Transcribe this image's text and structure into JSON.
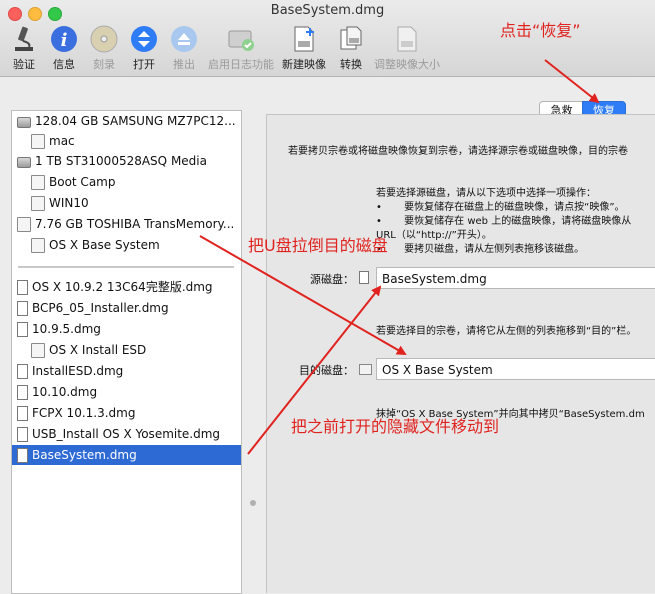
{
  "window": {
    "title": "BaseSystem.dmg"
  },
  "toolbar": {
    "items": [
      {
        "label": "验证",
        "enabled": true
      },
      {
        "label": "信息",
        "enabled": true
      },
      {
        "label": "刻录",
        "enabled": false
      },
      {
        "label": "打开",
        "enabled": true
      },
      {
        "label": "推出",
        "enabled": false
      },
      {
        "label": "启用日志功能",
        "enabled": false
      },
      {
        "label": "新建映像",
        "enabled": true
      },
      {
        "label": "转换",
        "enabled": true
      },
      {
        "label": "调整映像大小",
        "enabled": false
      }
    ]
  },
  "sidebar": {
    "items": [
      {
        "label": "128.04 GB SAMSUNG MZ7PC12...",
        "kind": "drive",
        "selected": false
      },
      {
        "label": "mac",
        "kind": "volume",
        "selected": false
      },
      {
        "label": "1 TB ST31000528ASQ Media",
        "kind": "drive",
        "selected": false
      },
      {
        "label": "Boot Camp",
        "kind": "volume",
        "selected": false
      },
      {
        "label": "WIN10",
        "kind": "volume",
        "selected": false
      },
      {
        "label": "7.76 GB TOSHIBA TransMemory...",
        "kind": "drive",
        "selected": false
      },
      {
        "label": "OS X Base System",
        "kind": "volume",
        "selected": false
      },
      {
        "label": "OS X 10.9.2 13C64完整版.dmg",
        "kind": "image",
        "selected": false
      },
      {
        "label": "BCP6_05_Installer.dmg",
        "kind": "image",
        "selected": false
      },
      {
        "label": "10.9.5.dmg",
        "kind": "image",
        "selected": false
      },
      {
        "label": "OS X Install ESD",
        "kind": "volume",
        "selected": false
      },
      {
        "label": "InstallESD.dmg",
        "kind": "image",
        "selected": false
      },
      {
        "label": "10.10.dmg",
        "kind": "image",
        "selected": false
      },
      {
        "label": "FCPX 10.1.3.dmg",
        "kind": "image",
        "selected": false
      },
      {
        "label": "USB_Install OS X Yosemite.dmg",
        "kind": "image",
        "selected": false
      },
      {
        "label": "BaseSystem.dmg",
        "kind": "image",
        "selected": true
      }
    ]
  },
  "tabs": {
    "first_aid": "急救",
    "restore": "恢复"
  },
  "restore": {
    "intro": "若要拷贝宗卷或将磁盘映像恢复到宗卷，请选择源宗卷或磁盘映像，目的宗卷",
    "source_help_title": "若要选择源磁盘，请从以下选项中选择一项操作：",
    "source_help_1": "要恢复储存在磁盘上的磁盘映像，请点按“映像”。",
    "source_help_2": "要恢复储存在 web 上的磁盘映像，请将磁盘映像从",
    "source_help_2b": "URL（以“http://”开头）。",
    "source_help_3": "要拷贝磁盘，请从左侧列表拖移该磁盘。",
    "source_label": "源磁盘：",
    "source_value": "BaseSystem.dmg",
    "dest_help": "若要选择目的宗卷，请将它从左侧的列表拖移到“目的”栏。",
    "dest_label": "目的磁盘：",
    "dest_value": "OS X Base System",
    "summary": "抹掉“OS X Base System”并向其中拷贝“BaseSystem.dm"
  },
  "annotations": {
    "click_restore": "点击“恢复”",
    "drag_usb": "把U盘拉倒目的磁盘",
    "drag_hidden": "把之前打开的隐藏文件移动到"
  },
  "colors": {
    "annotation": "#e0231f",
    "selection": "#2e6ad3",
    "tab_active": "#2f7df6"
  }
}
